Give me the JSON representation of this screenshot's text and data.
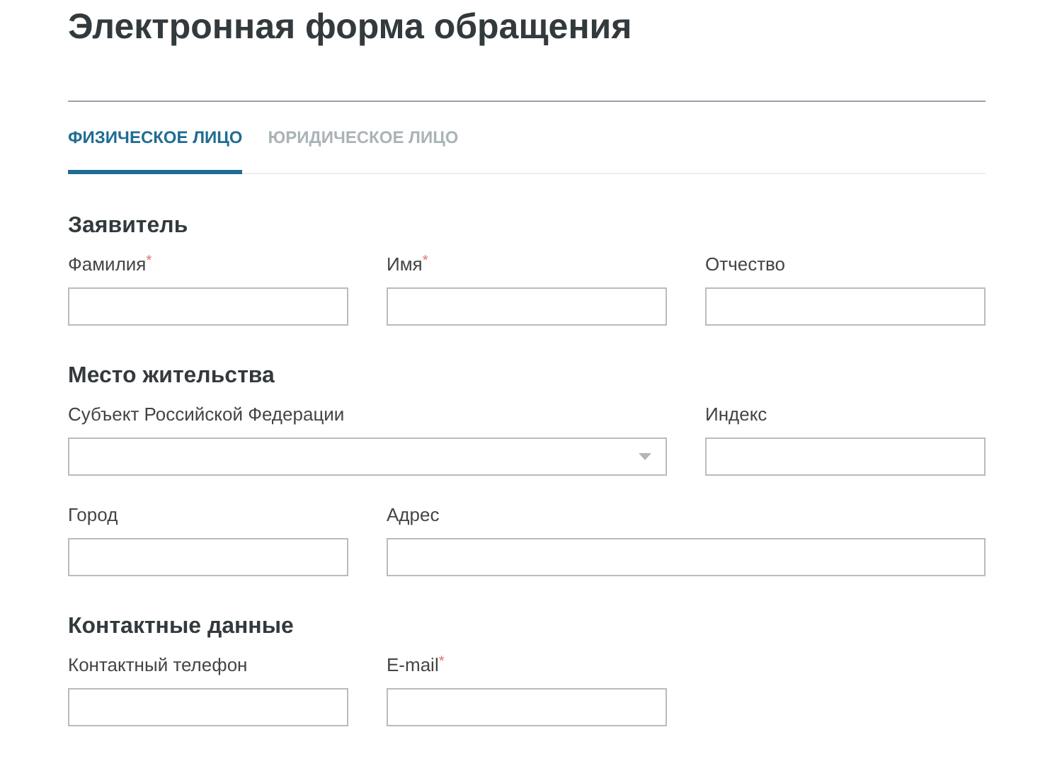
{
  "title": "Электронная форма обращения",
  "tabs": [
    {
      "label": "ФИЗИЧЕСКОЕ ЛИЦО",
      "selected": true
    },
    {
      "label": "ЮРИДИЧЕСКОЕ ЛИЦО",
      "selected": false
    }
  ],
  "sections": [
    {
      "title": "Заявитель",
      "fields": [
        {
          "label": "Фамилия",
          "required_mark": "*",
          "kind": "text"
        },
        {
          "label": "Имя",
          "required_mark": "*",
          "kind": "text"
        },
        {
          "label": "Отчество",
          "kind": "text"
        }
      ]
    },
    {
      "title": "Место жительства",
      "fields": [
        {
          "label": "Субъект Российской Федерации",
          "kind": "select"
        },
        {
          "label": "Индекс",
          "kind": "text"
        },
        {
          "label": "Город",
          "kind": "text"
        },
        {
          "label": "Адрес",
          "kind": "address"
        }
      ]
    },
    {
      "title": "Контактные данные",
      "fields": [
        {
          "label": "Контактный телефон",
          "kind": "text"
        },
        {
          "label": "E-mail",
          "required_mark": "*",
          "kind": "text"
        }
      ]
    }
  ]
}
